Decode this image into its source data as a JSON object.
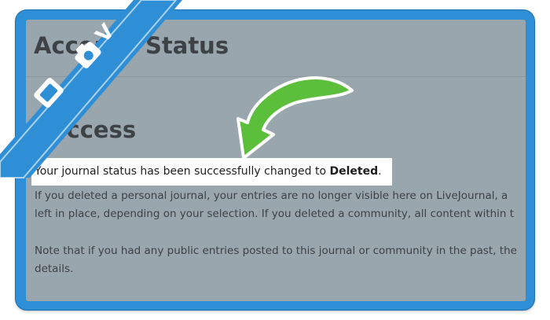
{
  "page": {
    "title": "Account Status",
    "success_heading": "Success",
    "status_message": {
      "prefix": "Your journal status has been successfully changed to ",
      "status": "Deleted",
      "suffix": "."
    },
    "paragraph1": {
      "line1": "If you deleted a personal journal, your entries are no longer visible here on LiveJournal, a",
      "line2": "left in place, depending on your selection. If you deleted a community, all content within t"
    },
    "paragraph2": {
      "line1": "Note that if you had any public entries posted to this journal or community in the past, the",
      "line2": "details."
    }
  },
  "banner": {
    "letter": "V",
    "icons": [
      "camera-icon",
      "tag-icon"
    ]
  },
  "colors": {
    "frame": "#2f8fd6",
    "screen_background": "#9aa6ad",
    "arrow": "#5cbf3c",
    "highlight": "#ffffff"
  }
}
